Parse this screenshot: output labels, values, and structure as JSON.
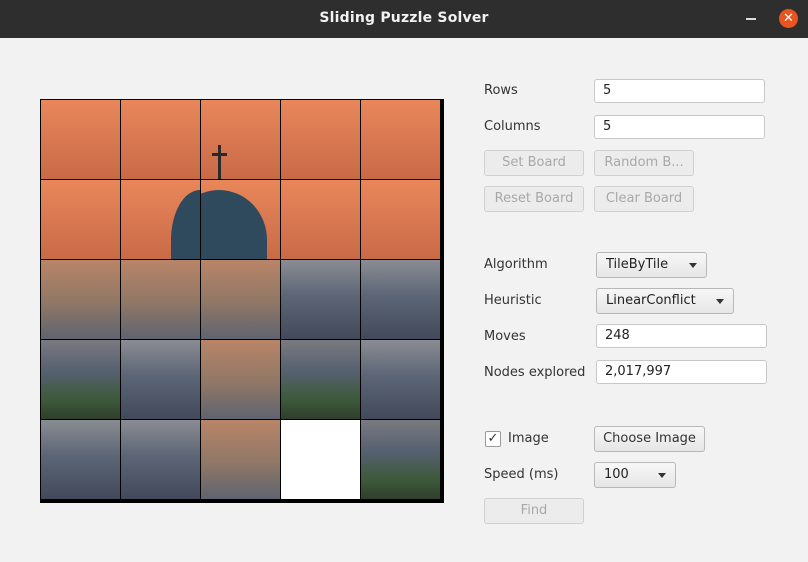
{
  "window": {
    "title": "Sliding Puzzle Solver",
    "close_glyph": "✕"
  },
  "form": {
    "rows_label": "Rows",
    "rows_value": "5",
    "columns_label": "Columns",
    "columns_value": "5",
    "set_board_label": "Set Board",
    "random_board_label": "Random B...",
    "reset_board_label": "Reset Board",
    "clear_board_label": "Clear Board",
    "algorithm_label": "Algorithm",
    "algorithm_value": "TileByTile",
    "heuristic_label": "Heuristic",
    "heuristic_value": "LinearConflict",
    "moves_label": "Moves",
    "moves_value": "248",
    "nodes_label": "Nodes explored",
    "nodes_value": "2,017,997",
    "image_checkbox_label": "Image",
    "image_checkbox_checked": true,
    "check_glyph": "✓",
    "choose_image_label": "Choose Image",
    "speed_label": "Speed (ms)",
    "speed_value": "100",
    "find_label": "Find"
  },
  "board": {
    "rows": 5,
    "columns": 5,
    "empty_cell": "row 5, column 4"
  },
  "icons": {
    "minimize": "minimize-icon",
    "close": "close-icon",
    "dropdown": "chevron-down-icon",
    "check": "check-icon"
  },
  "colors": {
    "accent_close": "#e95420",
    "titlebar": "#2e2e2e",
    "window_background": "#f2f2f2"
  }
}
